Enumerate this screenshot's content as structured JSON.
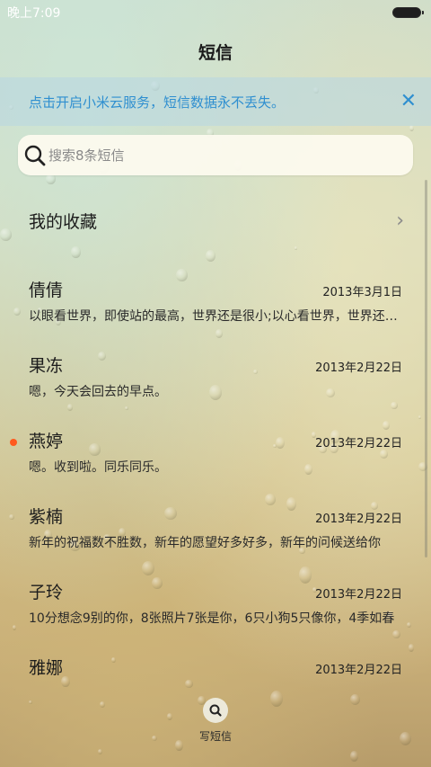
{
  "status_bar": {
    "time": "晚上7:09"
  },
  "header": {
    "title": "短信"
  },
  "cloud_banner": {
    "text": "点击开启小米云服务，短信数据永不丢失。",
    "close_icon": "close-icon"
  },
  "search": {
    "placeholder": "搜索8条短信",
    "icon": "search-icon"
  },
  "favorites": {
    "label": "我的收藏",
    "chevron": "›"
  },
  "threads": [
    {
      "name": "倩倩",
      "date": "2013年3月1日",
      "snippet": "以眼看世界，即使站的最高，世界还是很小;以心看世界，世界还是很大",
      "unread": false
    },
    {
      "name": "果冻",
      "date": "2013年2月22日",
      "snippet": "嗯，今天会回去的早点。",
      "unread": false
    },
    {
      "name": "燕婷",
      "date": "2013年2月22日",
      "snippet": "嗯。收到啦。同乐同乐。",
      "unread": true
    },
    {
      "name": "紫楠",
      "date": "2013年2月22日",
      "snippet": "新年的祝福数不胜数，新年的愿望好多好多，新年的问候送给你",
      "unread": false
    },
    {
      "name": "子玲",
      "date": "2013年2月22日",
      "snippet": "10分想念9别的你，8张照片7张是你，6只小狗5只像你，4季如春",
      "unread": false
    },
    {
      "name": "雅娜",
      "date": "2013年2月22日",
      "snippet": "",
      "unread": false
    }
  ],
  "compose": {
    "label": "写短信",
    "icon": "compose-icon"
  },
  "colors": {
    "accent": "#2f8fd0",
    "unread_dot": "#ff5a1e"
  }
}
